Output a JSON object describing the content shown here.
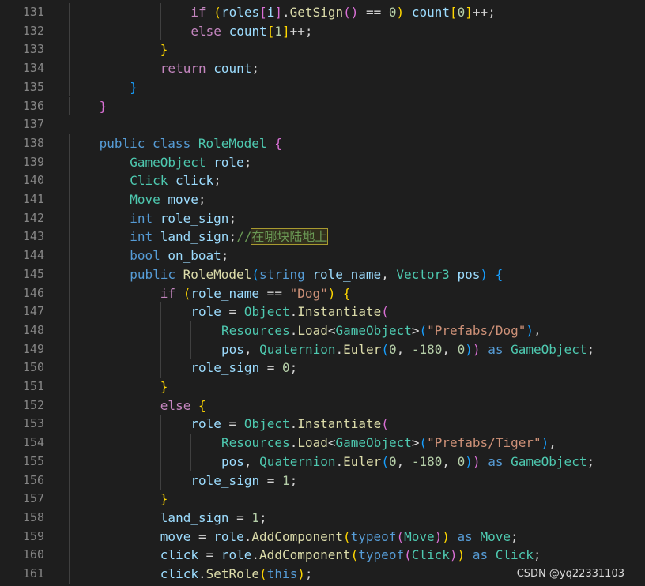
{
  "watermark": "CSDN @yq22331103",
  "lines": [
    {
      "n": "131",
      "indent": 4,
      "tokens": [
        [
          "ctl",
          "if"
        ],
        [
          "pn",
          " "
        ],
        [
          "br1",
          "("
        ],
        [
          "var",
          "roles"
        ],
        [
          "br2",
          "["
        ],
        [
          "var",
          "i"
        ],
        [
          "br2",
          "]"
        ],
        [
          "pn",
          "."
        ],
        [
          "fn",
          "GetSign"
        ],
        [
          "br2",
          "()"
        ],
        [
          "pn",
          " == "
        ],
        [
          "num",
          "0"
        ],
        [
          "br1",
          ")"
        ],
        [
          "pn",
          " "
        ],
        [
          "var",
          "count"
        ],
        [
          "br1",
          "["
        ],
        [
          "num",
          "0"
        ],
        [
          "br1",
          "]"
        ],
        [
          "pn",
          "++;"
        ]
      ]
    },
    {
      "n": "132",
      "indent": 4,
      "tokens": [
        [
          "ctl",
          "else"
        ],
        [
          "pn",
          " "
        ],
        [
          "var",
          "count"
        ],
        [
          "br1",
          "["
        ],
        [
          "num",
          "1"
        ],
        [
          "br1",
          "]"
        ],
        [
          "pn",
          "++;"
        ]
      ]
    },
    {
      "n": "133",
      "indent": 3,
      "tokens": [
        [
          "br1",
          "}"
        ]
      ]
    },
    {
      "n": "134",
      "indent": 3,
      "tokens": [
        [
          "ctl",
          "return"
        ],
        [
          "pn",
          " "
        ],
        [
          "var",
          "count"
        ],
        [
          "pn",
          ";"
        ]
      ]
    },
    {
      "n": "135",
      "indent": 2,
      "tokens": [
        [
          "br3",
          "}"
        ]
      ]
    },
    {
      "n": "136",
      "indent": 1,
      "tokens": [
        [
          "br2",
          "}"
        ]
      ]
    },
    {
      "n": "137",
      "indent": 0,
      "tokens": []
    },
    {
      "n": "138",
      "indent": 1,
      "tokens": [
        [
          "kw",
          "public"
        ],
        [
          "pn",
          " "
        ],
        [
          "kw",
          "class"
        ],
        [
          "pn",
          " "
        ],
        [
          "ty",
          "RoleModel"
        ],
        [
          "pn",
          " "
        ],
        [
          "br2",
          "{"
        ]
      ]
    },
    {
      "n": "139",
      "indent": 2,
      "tokens": [
        [
          "ty",
          "GameObject"
        ],
        [
          "pn",
          " "
        ],
        [
          "var",
          "role"
        ],
        [
          "pn",
          ";"
        ]
      ]
    },
    {
      "n": "140",
      "indent": 2,
      "tokens": [
        [
          "ty",
          "Click"
        ],
        [
          "pn",
          " "
        ],
        [
          "var",
          "click"
        ],
        [
          "pn",
          ";"
        ]
      ]
    },
    {
      "n": "141",
      "indent": 2,
      "tokens": [
        [
          "ty",
          "Move"
        ],
        [
          "pn",
          " "
        ],
        [
          "var",
          "move"
        ],
        [
          "pn",
          ";"
        ]
      ]
    },
    {
      "n": "142",
      "indent": 2,
      "tokens": [
        [
          "kw",
          "int"
        ],
        [
          "pn",
          " "
        ],
        [
          "var",
          "role_sign"
        ],
        [
          "pn",
          ";"
        ]
      ]
    },
    {
      "n": "143",
      "indent": 2,
      "tokens": [
        [
          "kw",
          "int"
        ],
        [
          "pn",
          " "
        ],
        [
          "var",
          "land_sign"
        ],
        [
          "pn",
          ";"
        ],
        [
          "cm",
          "//"
        ],
        [
          "cmhl",
          "在哪块陆地上"
        ]
      ]
    },
    {
      "n": "144",
      "indent": 2,
      "tokens": [
        [
          "kw",
          "bool"
        ],
        [
          "pn",
          " "
        ],
        [
          "var",
          "on_boat"
        ],
        [
          "pn",
          ";"
        ]
      ]
    },
    {
      "n": "145",
      "indent": 2,
      "tokens": [
        [
          "kw",
          "public"
        ],
        [
          "pn",
          " "
        ],
        [
          "fn",
          "RoleModel"
        ],
        [
          "br3",
          "("
        ],
        [
          "kw",
          "string"
        ],
        [
          "pn",
          " "
        ],
        [
          "var",
          "role_name"
        ],
        [
          "pn",
          ", "
        ],
        [
          "ty",
          "Vector3"
        ],
        [
          "pn",
          " "
        ],
        [
          "var",
          "pos"
        ],
        [
          "br3",
          ")"
        ],
        [
          "pn",
          " "
        ],
        [
          "br3",
          "{"
        ]
      ]
    },
    {
      "n": "146",
      "indent": 3,
      "tokens": [
        [
          "ctl",
          "if"
        ],
        [
          "pn",
          " "
        ],
        [
          "br1",
          "("
        ],
        [
          "var",
          "role_name"
        ],
        [
          "pn",
          " == "
        ],
        [
          "str",
          "\"Dog\""
        ],
        [
          "br1",
          ")"
        ],
        [
          "pn",
          " "
        ],
        [
          "br1",
          "{"
        ]
      ]
    },
    {
      "n": "147",
      "indent": 4,
      "tokens": [
        [
          "var",
          "role"
        ],
        [
          "pn",
          " = "
        ],
        [
          "ty",
          "Object"
        ],
        [
          "pn",
          "."
        ],
        [
          "fn",
          "Instantiate"
        ],
        [
          "br2",
          "("
        ]
      ]
    },
    {
      "n": "148",
      "indent": 5,
      "tokens": [
        [
          "ty",
          "Resources"
        ],
        [
          "pn",
          "."
        ],
        [
          "fn",
          "Load"
        ],
        [
          "pn",
          "<"
        ],
        [
          "ty",
          "GameObject"
        ],
        [
          "pn",
          ">"
        ],
        [
          "br3",
          "("
        ],
        [
          "str",
          "\"Prefabs/Dog\""
        ],
        [
          "br3",
          ")"
        ],
        [
          "pn",
          ","
        ]
      ]
    },
    {
      "n": "149",
      "indent": 5,
      "tokens": [
        [
          "var",
          "pos"
        ],
        [
          "pn",
          ", "
        ],
        [
          "ty",
          "Quaternion"
        ],
        [
          "pn",
          "."
        ],
        [
          "fn",
          "Euler"
        ],
        [
          "br3",
          "("
        ],
        [
          "num",
          "0"
        ],
        [
          "pn",
          ", "
        ],
        [
          "num",
          "-180"
        ],
        [
          "pn",
          ", "
        ],
        [
          "num",
          "0"
        ],
        [
          "br3",
          ")"
        ],
        [
          "br2",
          ")"
        ],
        [
          "pn",
          " "
        ],
        [
          "kw",
          "as"
        ],
        [
          "pn",
          " "
        ],
        [
          "ty",
          "GameObject"
        ],
        [
          "pn",
          ";"
        ]
      ]
    },
    {
      "n": "150",
      "indent": 4,
      "tokens": [
        [
          "var",
          "role_sign"
        ],
        [
          "pn",
          " = "
        ],
        [
          "num",
          "0"
        ],
        [
          "pn",
          ";"
        ]
      ]
    },
    {
      "n": "151",
      "indent": 3,
      "tokens": [
        [
          "br1",
          "}"
        ]
      ]
    },
    {
      "n": "152",
      "indent": 3,
      "tokens": [
        [
          "ctl",
          "else"
        ],
        [
          "pn",
          " "
        ],
        [
          "br1",
          "{"
        ]
      ]
    },
    {
      "n": "153",
      "indent": 4,
      "tokens": [
        [
          "var",
          "role"
        ],
        [
          "pn",
          " = "
        ],
        [
          "ty",
          "Object"
        ],
        [
          "pn",
          "."
        ],
        [
          "fn",
          "Instantiate"
        ],
        [
          "br2",
          "("
        ]
      ]
    },
    {
      "n": "154",
      "indent": 5,
      "tokens": [
        [
          "ty",
          "Resources"
        ],
        [
          "pn",
          "."
        ],
        [
          "fn",
          "Load"
        ],
        [
          "pn",
          "<"
        ],
        [
          "ty",
          "GameObject"
        ],
        [
          "pn",
          ">"
        ],
        [
          "br3",
          "("
        ],
        [
          "str",
          "\"Prefabs/Tiger\""
        ],
        [
          "br3",
          ")"
        ],
        [
          "pn",
          ","
        ]
      ]
    },
    {
      "n": "155",
      "indent": 5,
      "tokens": [
        [
          "var",
          "pos"
        ],
        [
          "pn",
          ", "
        ],
        [
          "ty",
          "Quaternion"
        ],
        [
          "pn",
          "."
        ],
        [
          "fn",
          "Euler"
        ],
        [
          "br3",
          "("
        ],
        [
          "num",
          "0"
        ],
        [
          "pn",
          ", "
        ],
        [
          "num",
          "-180"
        ],
        [
          "pn",
          ", "
        ],
        [
          "num",
          "0"
        ],
        [
          "br3",
          ")"
        ],
        [
          "br2",
          ")"
        ],
        [
          "pn",
          " "
        ],
        [
          "kw",
          "as"
        ],
        [
          "pn",
          " "
        ],
        [
          "ty",
          "GameObject"
        ],
        [
          "pn",
          ";"
        ]
      ]
    },
    {
      "n": "156",
      "indent": 4,
      "tokens": [
        [
          "var",
          "role_sign"
        ],
        [
          "pn",
          " = "
        ],
        [
          "num",
          "1"
        ],
        [
          "pn",
          ";"
        ]
      ]
    },
    {
      "n": "157",
      "indent": 3,
      "tokens": [
        [
          "br1",
          "}"
        ]
      ]
    },
    {
      "n": "158",
      "indent": 3,
      "tokens": [
        [
          "var",
          "land_sign"
        ],
        [
          "pn",
          " = "
        ],
        [
          "num",
          "1"
        ],
        [
          "pn",
          ";"
        ]
      ]
    },
    {
      "n": "159",
      "indent": 3,
      "tokens": [
        [
          "var",
          "move"
        ],
        [
          "pn",
          " = "
        ],
        [
          "var",
          "role"
        ],
        [
          "pn",
          "."
        ],
        [
          "fn",
          "AddComponent"
        ],
        [
          "br1",
          "("
        ],
        [
          "kw",
          "typeof"
        ],
        [
          "br2",
          "("
        ],
        [
          "ty",
          "Move"
        ],
        [
          "br2",
          ")"
        ],
        [
          "br1",
          ")"
        ],
        [
          "pn",
          " "
        ],
        [
          "kw",
          "as"
        ],
        [
          "pn",
          " "
        ],
        [
          "ty",
          "Move"
        ],
        [
          "pn",
          ";"
        ]
      ]
    },
    {
      "n": "160",
      "indent": 3,
      "tokens": [
        [
          "var",
          "click"
        ],
        [
          "pn",
          " = "
        ],
        [
          "var",
          "role"
        ],
        [
          "pn",
          "."
        ],
        [
          "fn",
          "AddComponent"
        ],
        [
          "br1",
          "("
        ],
        [
          "kw",
          "typeof"
        ],
        [
          "br2",
          "("
        ],
        [
          "ty",
          "Click"
        ],
        [
          "br2",
          ")"
        ],
        [
          "br1",
          ")"
        ],
        [
          "pn",
          " "
        ],
        [
          "kw",
          "as"
        ],
        [
          "pn",
          " "
        ],
        [
          "ty",
          "Click"
        ],
        [
          "pn",
          ";"
        ]
      ]
    },
    {
      "n": "161",
      "indent": 3,
      "tokens": [
        [
          "var",
          "click"
        ],
        [
          "pn",
          "."
        ],
        [
          "fn",
          "SetRole"
        ],
        [
          "br1",
          "("
        ],
        [
          "kw",
          "this"
        ],
        [
          "br1",
          ")"
        ],
        [
          "pn",
          ";"
        ]
      ]
    }
  ]
}
